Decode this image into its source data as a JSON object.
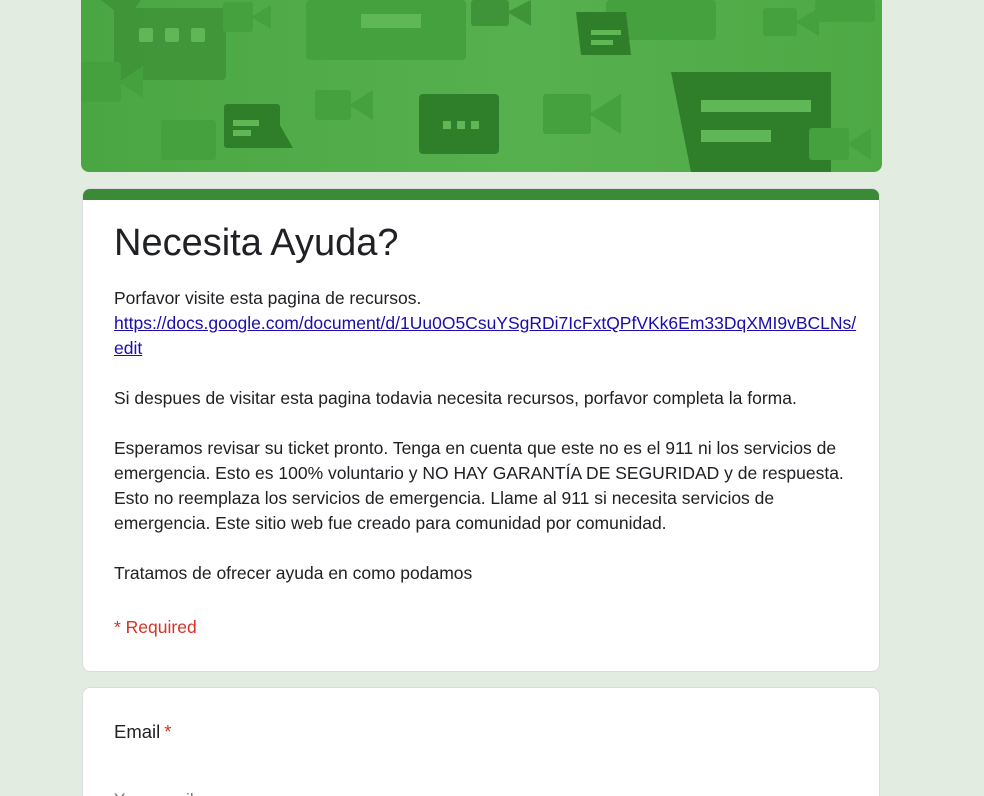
{
  "form": {
    "title": "Necesita Ayuda?",
    "description": {
      "line1": "Porfavor visite esta pagina de recursos.",
      "link": "https://docs.google.com/document/d/1Uu0O5CsuYSgRDi7IcFxtQPfVKk6Em33DqXMI9vBCLNs/edit",
      "para2": "Si despues de visitar esta pagina todavia necesita recursos, porfavor completa la forma.",
      "para3": "Esperamos revisar su ticket pronto. Tenga en cuenta que este no es el 911 ni los servicios de emergencia. Esto es 100% voluntario y NO HAY GARANTÍA DE SEGURIDAD y de respuesta. Esto no reemplaza los servicios de emergencia. Llame al 911 si necesita servicios de emergencia. Este sitio web fue creado para comunidad por comunidad.",
      "para4": "Tratamos de ofrecer ayuda en como podamos"
    },
    "required_note": "* Required"
  },
  "email_question": {
    "label": "Email",
    "required_marker": "*",
    "placeholder": "Your email"
  },
  "colors": {
    "background": "#e3ece1",
    "banner_green": "#4ea945",
    "accent_bar": "#3b8a35",
    "link": "#1a0dab",
    "required_red": "#d93025"
  },
  "icons": {
    "banner_pattern": "chat-and-video-camera-pattern"
  }
}
